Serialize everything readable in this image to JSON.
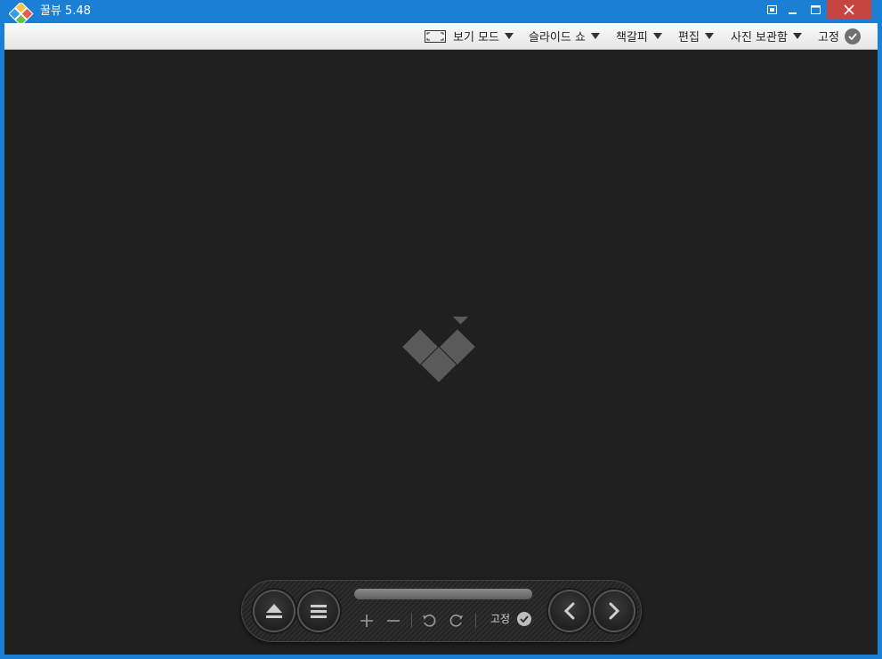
{
  "window": {
    "title": "꿀뷰 5.48",
    "controls": [
      "fullscreen-icon",
      "minimize-icon",
      "maximize-icon",
      "close-icon"
    ],
    "colors": {
      "titlebar": "#1b7fd6",
      "close": "#c7463f",
      "viewer_bg": "#202020"
    }
  },
  "toolbar": {
    "items": [
      {
        "label": "보기 모드",
        "icon": "screen-frame-icon",
        "has_dropdown": true
      },
      {
        "label": "슬라이드 쇼",
        "has_dropdown": true
      },
      {
        "label": "책갈피",
        "has_dropdown": true
      },
      {
        "label": "편집",
        "has_dropdown": true
      },
      {
        "label": "사진 보관함",
        "has_dropdown": true
      },
      {
        "label": "고정",
        "icon": "check-circle-icon",
        "has_dropdown": false
      }
    ]
  },
  "viewer": {
    "placeholder_icon": "honeyview-logo-icon"
  },
  "control_bar": {
    "buttons": [
      "eject-icon",
      "menu-icon",
      "zoom-in-icon",
      "zoom-out-icon",
      "rotate-left-icon",
      "rotate-right-icon",
      "prev-icon",
      "next-icon"
    ],
    "pin_label": "고정",
    "progress": 0
  }
}
